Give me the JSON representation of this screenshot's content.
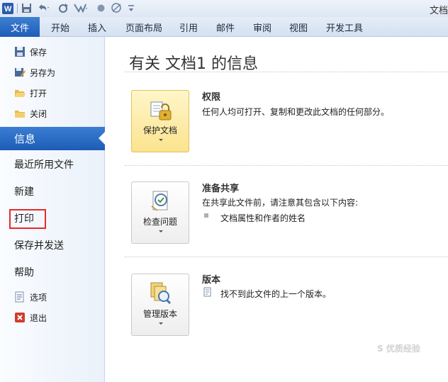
{
  "window": {
    "title": "文档"
  },
  "ribbon": {
    "file_tab": "文件",
    "tabs": [
      "开始",
      "插入",
      "页面布局",
      "引用",
      "邮件",
      "审阅",
      "视图",
      "开发工具"
    ]
  },
  "nav": {
    "small_top": [
      "保存",
      "另存为",
      "打开",
      "关闭"
    ],
    "info": "信息",
    "recent": "最近所用文件",
    "new": "新建",
    "print": "打印",
    "save_send": "保存并发送",
    "help": "帮助",
    "options": "选项",
    "exit": "退出"
  },
  "main": {
    "title": "有关 文档1 的信息",
    "sections": [
      {
        "button": "保护文档",
        "title": "权限",
        "desc": "任何人均可打开、复制和更改此文档的任何部分。"
      },
      {
        "button": "检查问题",
        "title": "准备共享",
        "desc": "在共享此文件前，请注意其包含以下内容:",
        "bullet": "文档属性和作者的姓名"
      },
      {
        "button": "管理版本",
        "title": "版本",
        "desc": "找不到此文件的上一个版本。"
      }
    ]
  },
  "watermark": "S 优质经验",
  "colors": {
    "file_tab": "#2b6cc4",
    "print_highlight": "#e52b2b",
    "protect_button": "#fbe38e"
  }
}
